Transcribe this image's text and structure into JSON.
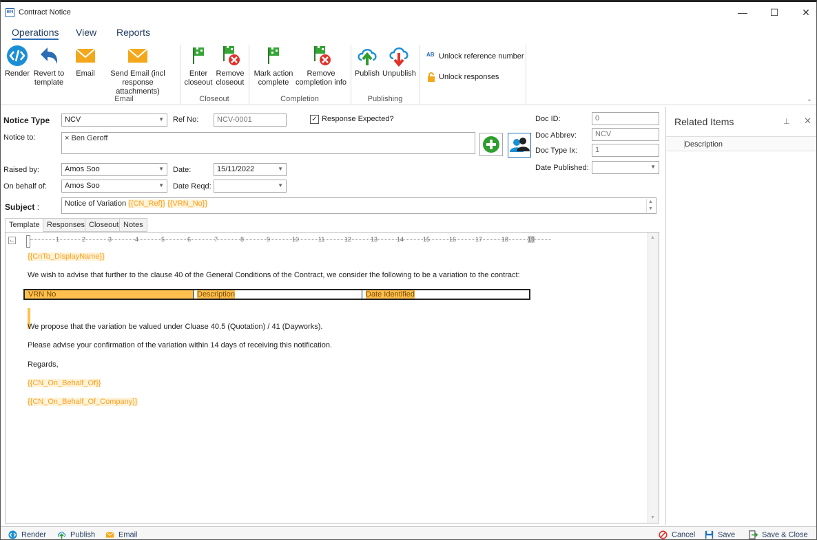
{
  "window": {
    "title": "Contract Notice",
    "app_icon": "RFI"
  },
  "menu": {
    "tabs": [
      "Operations",
      "View",
      "Reports"
    ]
  },
  "ribbon": {
    "render": "Render",
    "revert": [
      "Revert to",
      "template"
    ],
    "email": "Email",
    "send_email": [
      "Send Email (incl",
      "response attachments)"
    ],
    "enter_closeout": [
      "Enter",
      "closeout"
    ],
    "remove_closeout": [
      "Remove",
      "closeout"
    ],
    "mark_action": [
      "Mark action",
      "complete"
    ],
    "remove_completion": [
      "Remove",
      "completion info"
    ],
    "publish": "Publish",
    "unpublish": "Unpublish",
    "unlock_ref": "Unlock reference number",
    "unlock_ref_icon": "AB",
    "unlock_responses": "Unlock responses",
    "groups": {
      "email": "Email",
      "closeout": "Closeout",
      "completion": "Completion",
      "publishing": "Publishing"
    }
  },
  "form": {
    "notice_type_label": "Notice Type",
    "notice_type": "NCV",
    "ref_no_label": "Ref No:",
    "ref_no": "NCV-0001",
    "response_expected": "Response Expected?",
    "notice_to_label": "Notice to:",
    "notice_to": "× Ben  Geroff",
    "raised_by_label": "Raised by:",
    "raised_by": "Amos Soo",
    "date_label": "Date:",
    "date": "15/11/2022",
    "on_behalf_label": "On behalf of:",
    "on_behalf": "Amos Soo",
    "date_reqd_label": "Date Reqd:",
    "date_reqd": "",
    "subject_label": "Subject",
    "subject_colon": ":",
    "subject_text": "Notice of Variation",
    "subject_tag1": "{{CN_Ref}}",
    "subject_tag2": "{{VRN_No}}",
    "doc_id_label": "Doc ID:",
    "doc_id": "0",
    "doc_abbrev_label": "Doc Abbrev:",
    "doc_abbrev": "NCV",
    "doc_type_ix_label": "Doc Type Ix:",
    "doc_type_ix": "1",
    "date_published_label": "Date Published:",
    "date_published": ""
  },
  "tabs": [
    "Template",
    "Responses",
    "Closeout",
    "Notes"
  ],
  "ruler": [
    "1",
    "2",
    "3",
    "4",
    "5",
    "6",
    "7",
    "8",
    "9",
    "10",
    "11",
    "12",
    "13",
    "14",
    "15",
    "16",
    "17",
    "18",
    "19"
  ],
  "doc": {
    "to_tag": "{{CnTo_DisplayName}}",
    "p1": "We wish to advise that further to the clause 40 of the General Conditions of the Contract, we consider the following to be a variation to the contract:",
    "table_headers": [
      "VRN No",
      "Description",
      "Date Identified"
    ],
    "p2": "We propose that the variation be valued under Cluase 40.5 (Quotation) / 41 (Dayworks).",
    "p3": "Please advise your confirmation of the variation within 14 days of receiving this notification.",
    "regards": "Regards,",
    "tag_behalf": "{{CN_On_Behalf_Of}}",
    "tag_company": "{{CN_On_Behalf_Of_Company}}"
  },
  "side": {
    "title": "Related Items",
    "column": "Description"
  },
  "status": {
    "render": "Render",
    "publish": "Publish",
    "email": "Email",
    "cancel": "Cancel",
    "save": "Save",
    "save_close": "Save & Close"
  }
}
